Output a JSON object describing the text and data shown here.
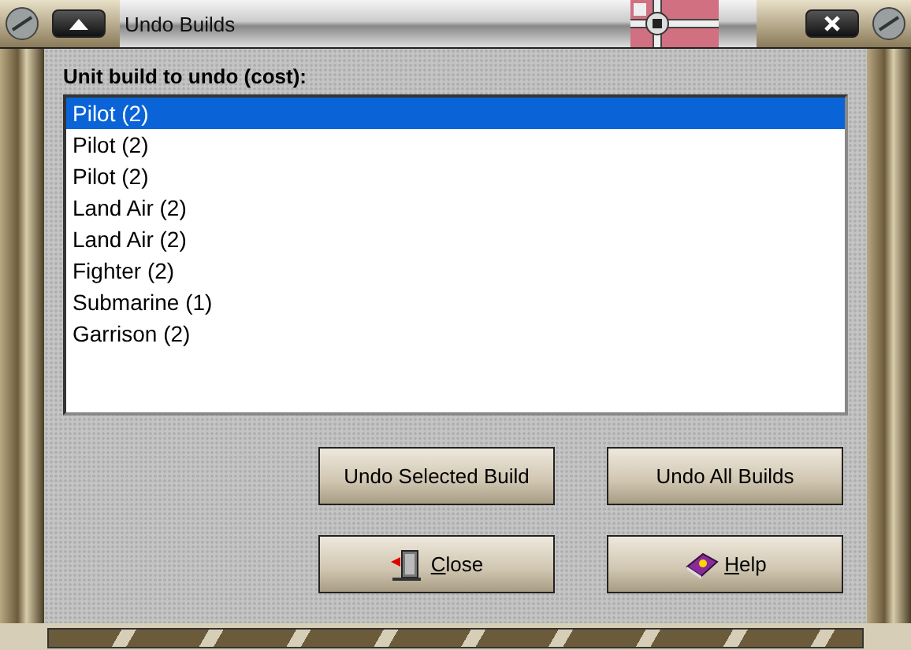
{
  "window": {
    "title": "Undo Builds"
  },
  "list_label": "Unit build to undo (cost):",
  "units": [
    {
      "label": "Pilot (2)",
      "selected": true
    },
    {
      "label": "Pilot (2)",
      "selected": false
    },
    {
      "label": "Pilot (2)",
      "selected": false
    },
    {
      "label": "Land Air (2)",
      "selected": false
    },
    {
      "label": "Land Air (2)",
      "selected": false
    },
    {
      "label": "Fighter (2)",
      "selected": false
    },
    {
      "label": "Submarine (1)",
      "selected": false
    },
    {
      "label": "Garrison (2)",
      "selected": false
    }
  ],
  "buttons": [
    {
      "label": "Undo Selected Build",
      "kind": "plain"
    },
    {
      "label": "Undo All Builds",
      "kind": "plain"
    },
    {
      "label": "Close",
      "kind": "close"
    },
    {
      "label": "Help",
      "kind": "help"
    }
  ]
}
